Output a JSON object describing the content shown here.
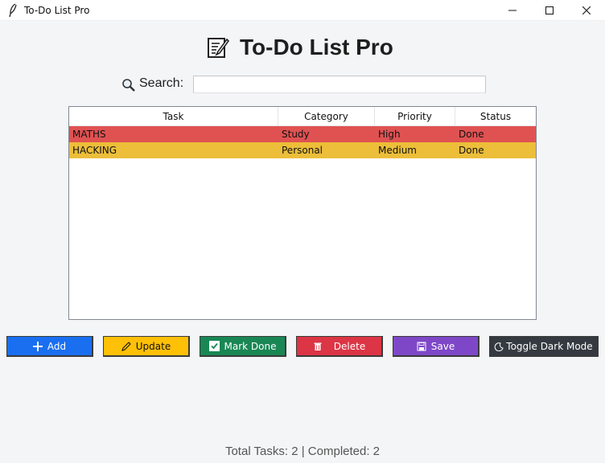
{
  "window": {
    "title": "To-Do List Pro"
  },
  "header": {
    "title": "To-Do List Pro",
    "icon": "memo-icon"
  },
  "search": {
    "label": "Search:",
    "value": "",
    "placeholder": ""
  },
  "table": {
    "columns": [
      "Task",
      "Category",
      "Priority",
      "Status"
    ],
    "rows": [
      {
        "task": "MATHS",
        "category": "Study",
        "priority": "High",
        "status": "Done",
        "color": "#e05252"
      },
      {
        "task": "HACKING",
        "category": "Personal",
        "priority": "Medium",
        "status": "Done",
        "color": "#ecbe39"
      }
    ]
  },
  "buttons": {
    "add": {
      "label": "Add",
      "color": "#1a6ff0"
    },
    "update": {
      "label": "Update",
      "color": "#ffc008"
    },
    "mark_done": {
      "label": "Mark Done",
      "color": "#198754"
    },
    "delete": {
      "label": "Delete",
      "color": "#dc3545"
    },
    "save": {
      "label": "Save",
      "color": "#7e47c8"
    },
    "dark_mode": {
      "label": "Toggle Dark Mode",
      "color": "#343a40"
    }
  },
  "footer": {
    "status": "Total Tasks: 2 | Completed: 2"
  }
}
